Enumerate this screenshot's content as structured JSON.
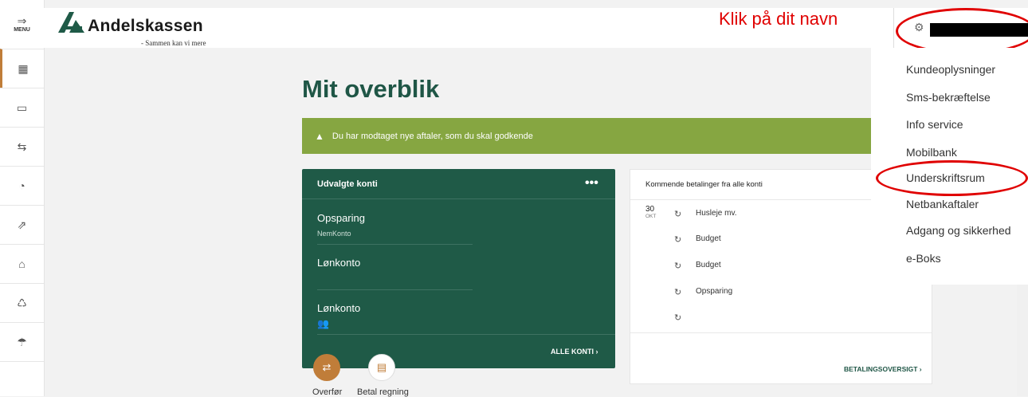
{
  "sidebar": {
    "menu_label": "MENU",
    "items": [
      {
        "icon": "dashboard-icon",
        "glyph": "▦",
        "active": true
      },
      {
        "icon": "card-icon",
        "glyph": "▭"
      },
      {
        "icon": "transfer-icon",
        "glyph": "⇆"
      },
      {
        "icon": "chart-pie-icon",
        "glyph": "◔"
      },
      {
        "icon": "growth-icon",
        "glyph": "⇗"
      },
      {
        "icon": "home-icon",
        "glyph": "⌂"
      },
      {
        "icon": "piggybank-icon",
        "glyph": "♺"
      },
      {
        "icon": "umbrella-icon",
        "glyph": "☂"
      }
    ]
  },
  "header": {
    "logo_text": "Andelskassen",
    "logo_tagline": "- Sammen kan vi mere",
    "annotation": "Klik på dit navn",
    "gear_glyph": "⚙"
  },
  "main": {
    "title": "Mit overblik",
    "alert_icon": "▲",
    "alert_text": "Du har modtaget nye aftaler, som du skal godkende"
  },
  "accounts": {
    "heading": "Udvalgte konti",
    "more": "•••",
    "items": [
      {
        "name": "Opsparing",
        "sub": "NemKonto"
      },
      {
        "name": "Lønkonto",
        "sub": ""
      },
      {
        "name": "Lønkonto",
        "sub": ""
      }
    ],
    "shared_glyph": "👥",
    "all_link": "ALLE KONTI ›"
  },
  "quick_actions": [
    {
      "label": "Overfør",
      "glyph": "⇄"
    },
    {
      "label": "Betal regning",
      "glyph": "▤"
    }
  ],
  "payments": {
    "heading": "Kommende betalinger fra alle konti",
    "date_day": "30",
    "date_month": "OKT",
    "recur_glyph": "↻",
    "items": [
      "Husleje mv.",
      "Budget",
      "Budget",
      "Opsparing",
      ""
    ],
    "overview_link": "BETALINGSOVERSIGT ›"
  },
  "user_menu": {
    "items": [
      "Kundeoplysninger",
      "Sms-bekræftelse",
      "Info service",
      "Mobilbank",
      "Underskriftsrum",
      "Netbankaftaler",
      "Adgang og sikkerhed",
      "e-Boks"
    ]
  },
  "colors": {
    "brand_green": "#1f5a47",
    "alert_green": "#86a641",
    "accent_orange": "#c07d39",
    "annotation_red": "#e00000"
  }
}
